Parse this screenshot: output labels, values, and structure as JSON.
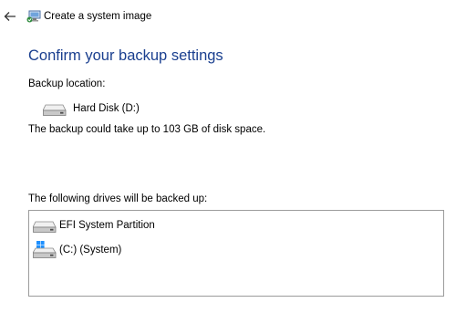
{
  "window": {
    "title": "Create a system image",
    "icons": {
      "back": "back-arrow-icon",
      "app": "system-image-backup-icon"
    }
  },
  "main": {
    "heading": "Confirm your backup settings",
    "backup_location_label": "Backup location:",
    "backup_location": {
      "name": "Hard Disk (D:)",
      "icon": "hard-disk-icon"
    },
    "space_note": "The backup could take up to 103 GB of disk space.",
    "drives_label": "The following drives will be backed up:",
    "drives": [
      {
        "name": "EFI System Partition",
        "icon": "hard-disk-icon"
      },
      {
        "name": "(C:) (System)",
        "icon": "windows-system-drive-icon"
      }
    ]
  },
  "colors": {
    "heading": "#1a3f8f",
    "windows_logo": "#1e90ff"
  }
}
